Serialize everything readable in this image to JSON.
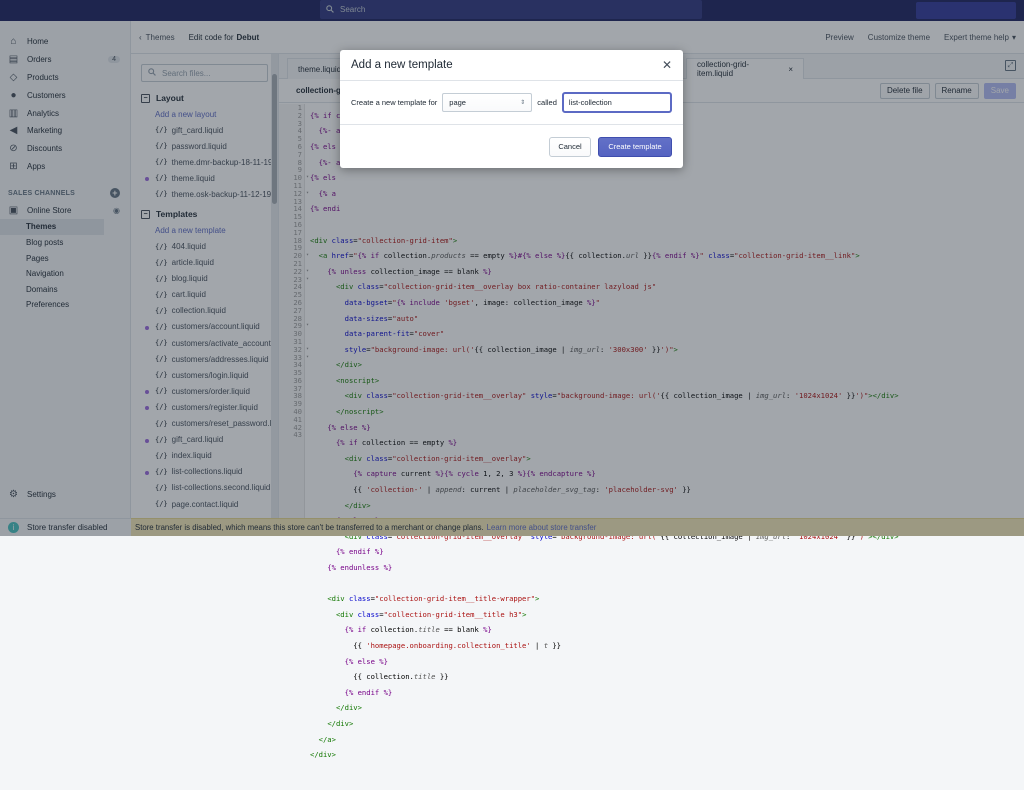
{
  "topbar": {
    "search_placeholder": "Search"
  },
  "sidebar": {
    "items": [
      {
        "label": "Home",
        "icon": "home-icon"
      },
      {
        "label": "Orders",
        "icon": "orders-icon",
        "badge": "4"
      },
      {
        "label": "Products",
        "icon": "tag-icon"
      },
      {
        "label": "Customers",
        "icon": "customers-icon"
      },
      {
        "label": "Analytics",
        "icon": "analytics-icon"
      },
      {
        "label": "Marketing",
        "icon": "marketing-icon"
      },
      {
        "label": "Discounts",
        "icon": "discounts-icon"
      },
      {
        "label": "Apps",
        "icon": "apps-icon"
      }
    ],
    "sales_channels_label": "SALES CHANNELS",
    "online_store": "Online Store",
    "subitems": [
      "Themes",
      "Blog posts",
      "Pages",
      "Navigation",
      "Domains",
      "Preferences"
    ],
    "settings": "Settings",
    "store_transfer": "Store transfer disabled"
  },
  "header": {
    "back": "Themes",
    "edit_prefix": "Edit code for",
    "theme_name": "Debut",
    "preview": "Preview",
    "customize": "Customize theme",
    "actions": "Expert theme help"
  },
  "files": {
    "search_placeholder": "Search files...",
    "layout_label": "Layout",
    "add_layout": "Add a new layout",
    "layout_files": [
      {
        "name": "gift_card.liquid",
        "dot": false
      },
      {
        "name": "password.liquid",
        "dot": false
      },
      {
        "name": "theme.dmr-backup-18-11-19_",
        "dot": false
      },
      {
        "name": "theme.liquid",
        "dot": true
      },
      {
        "name": "theme.osk-backup-11-12-19_",
        "dot": false
      }
    ],
    "templates_label": "Templates",
    "add_template": "Add a new template",
    "template_files": [
      {
        "name": "404.liquid",
        "dot": false
      },
      {
        "name": "article.liquid",
        "dot": false
      },
      {
        "name": "blog.liquid",
        "dot": false
      },
      {
        "name": "cart.liquid",
        "dot": false
      },
      {
        "name": "collection.liquid",
        "dot": false
      },
      {
        "name": "customers/account.liquid",
        "dot": true
      },
      {
        "name": "customers/activate_account.li",
        "dot": false
      },
      {
        "name": "customers/addresses.liquid",
        "dot": false
      },
      {
        "name": "customers/login.liquid",
        "dot": false
      },
      {
        "name": "customers/order.liquid",
        "dot": true
      },
      {
        "name": "customers/register.liquid",
        "dot": true
      },
      {
        "name": "customers/reset_password.lic",
        "dot": false
      },
      {
        "name": "gift_card.liquid",
        "dot": true
      },
      {
        "name": "index.liquid",
        "dot": false
      },
      {
        "name": "list-collections.liquid",
        "dot": true
      },
      {
        "name": "list-collections.second.liquid",
        "dot": false
      },
      {
        "name": "page.contact.liquid",
        "dot": false
      }
    ]
  },
  "editor": {
    "tabs": [
      "theme.liquid",
      "collection-grid-item.liquid"
    ],
    "file_title": "collection-gr",
    "delete_btn": "Delete file",
    "rename_btn": "Rename",
    "save_btn": "Save",
    "fold_lines": [
      10,
      12,
      20,
      22,
      23,
      29,
      32,
      33
    ],
    "line_count": 43
  },
  "modal": {
    "title": "Add a new template",
    "create_label": "Create a new template for",
    "select_value": "page",
    "called_label": "called",
    "input_value": "list-collection",
    "cancel": "Cancel",
    "create": "Create template"
  },
  "banner": {
    "text": "Store transfer is disabled, which means this store can't be transferred to a merchant or change plans.",
    "link": "Learn more about store transfer"
  },
  "colors": {
    "topbar": "#1c2260",
    "accent": "#5c6ac4",
    "banner": "#f5e9b8"
  }
}
